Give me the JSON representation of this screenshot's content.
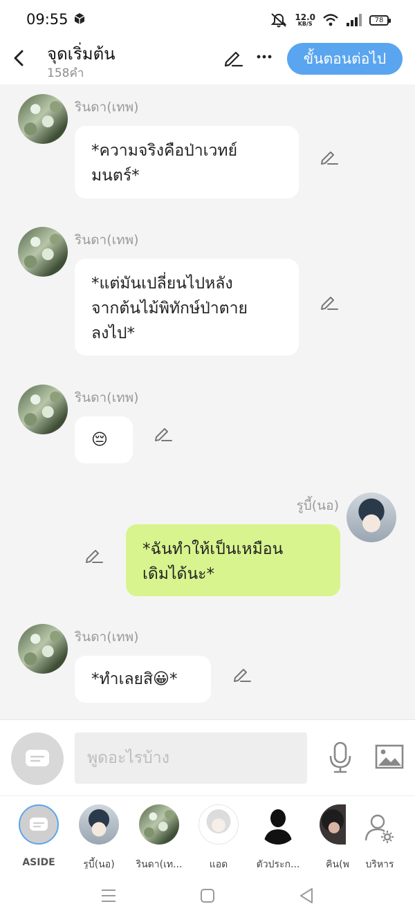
{
  "status_bar": {
    "time": "09:55",
    "net_speed": "12.0",
    "net_unit": "KB/S",
    "battery": "78",
    "icons": [
      "cube-icon",
      "mute-icon",
      "wifi-icon",
      "signal-icon",
      "battery-icon"
    ]
  },
  "header": {
    "title": "จุดเริ่มต้น",
    "word_count": "158คำ",
    "next_label": "ขั้นตอนต่อไป",
    "icons": [
      "back-icon",
      "pencil-icon",
      "more-icon"
    ]
  },
  "messages": [
    {
      "sender": "รินดา(เทพ)",
      "lines": [
        "*ความจริงคือป่าเวทย์",
        "มนตร์*"
      ],
      "side": "left"
    },
    {
      "sender": "รินดา(เทพ)",
      "lines": [
        "*แต่มันเปลี่ยนไปหลัง",
        "จากต้นไม้พิทักษ์ป่าตาย",
        "ลงไป*"
      ],
      "side": "left"
    },
    {
      "sender": "รินดา(เทพ)",
      "lines": [
        "😔"
      ],
      "side": "left"
    },
    {
      "sender": "รูบี้(นอ)",
      "lines": [
        "*ฉันทำให้เป็นเหมือน",
        "เดิมได้นะ*"
      ],
      "side": "right"
    },
    {
      "sender": "รินดา(เทพ)",
      "lines": [
        "*ทำเลยสิ😀*"
      ],
      "side": "left"
    }
  ],
  "composer": {
    "placeholder": "พูดอะไรบ้าง",
    "value": "",
    "icons": [
      "chat-bubble-icon",
      "microphone-icon",
      "image-icon"
    ]
  },
  "characters": [
    {
      "label": "ASIDE",
      "selected": true
    },
    {
      "label": "รูบี้(นอ)"
    },
    {
      "label": "รินดา(เท..."
    },
    {
      "label": "แอด"
    },
    {
      "label": "ตัวประก..."
    },
    {
      "label": "คิน(พ"
    },
    {
      "label": "บริหาร"
    }
  ],
  "nav_bar": {
    "icons": [
      "menu-icon",
      "home-icon",
      "back-triangle-icon"
    ]
  },
  "colors": {
    "accent": "#5aa5ef",
    "my_bubble": "#d8f48e",
    "other_bubble": "#ffffff",
    "chat_background": "#f4f4f4"
  }
}
